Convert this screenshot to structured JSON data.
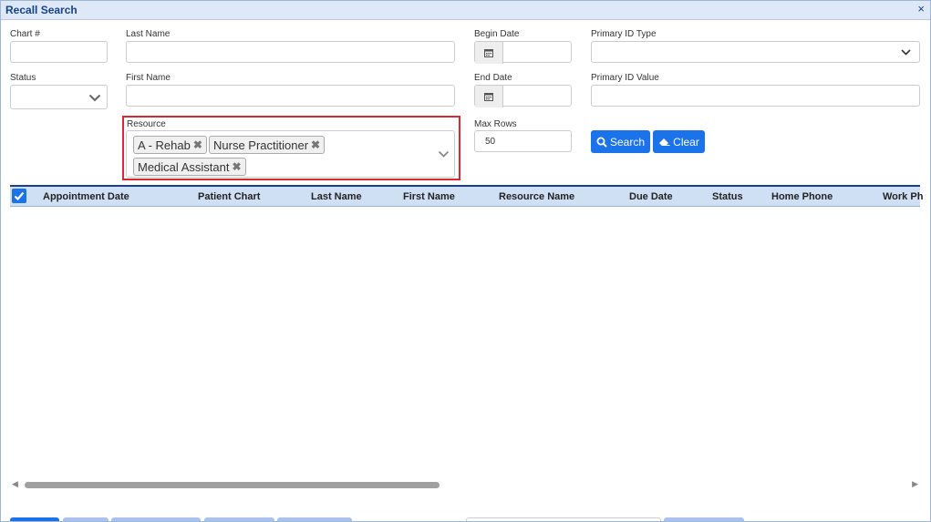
{
  "window": {
    "title": "Recall Search",
    "close_label": "×"
  },
  "form": {
    "chart_label": "Chart #",
    "chart_value": "",
    "last_name_label": "Last Name",
    "last_name_value": "",
    "begin_date_label": "Begin Date",
    "begin_date_value": "",
    "primary_id_type_label": "Primary ID Type",
    "primary_id_type_value": "",
    "status_label": "Status",
    "status_value": "",
    "first_name_label": "First Name",
    "first_name_value": "",
    "end_date_label": "End Date",
    "end_date_value": "",
    "primary_id_value_label": "Primary ID Value",
    "primary_id_value_value": "",
    "resource_label": "Resource",
    "resource_tags": [
      "A - Rehab",
      "Nurse Practitioner",
      "Medical Assistant"
    ],
    "max_rows_label": "Max Rows",
    "max_rows_value": "50"
  },
  "buttons": {
    "search_label": "Search",
    "clear_label": "Clear"
  },
  "grid": {
    "columns": [
      "Appointment Date",
      "Patient Chart",
      "Last Name",
      "First Name",
      "Resource Name",
      "Due Date",
      "Status",
      "Home Phone",
      "Work Ph"
    ],
    "select_all_checked": true
  },
  "scrollbar": {
    "left_arrow": "◀",
    "right_arrow": "▶"
  },
  "colors": {
    "accent": "#1a73e8",
    "highlight_border": "#d9282e",
    "header_bg": "#cfe0f5",
    "title_text": "#15428b"
  },
  "icons": [
    "calendar-icon",
    "chevron-down-icon",
    "search-icon",
    "eraser-icon",
    "check-icon",
    "close-icon"
  ]
}
